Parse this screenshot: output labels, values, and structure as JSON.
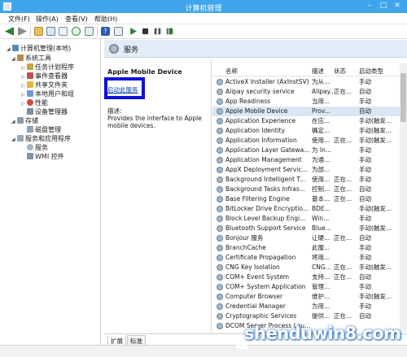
{
  "window": {
    "title": "计算机管理"
  },
  "menu": [
    "文件(F)",
    "操作(A)",
    "查看(V)",
    "帮助(H)"
  ],
  "tree": [
    {
      "label": "计算机管理(本地)",
      "level": 0,
      "expanded": true,
      "icon": "computer-icon"
    },
    {
      "label": "系统工具",
      "level": 1,
      "expanded": true,
      "icon": "tools-icon"
    },
    {
      "label": "任务计划程序",
      "level": 2,
      "expanded": false,
      "icon": "task-scheduler-icon"
    },
    {
      "label": "事件查看器",
      "level": 2,
      "expanded": false,
      "icon": "event-viewer-icon"
    },
    {
      "label": "共享文件夹",
      "level": 2,
      "expanded": false,
      "icon": "shared-folder-icon"
    },
    {
      "label": "本地用户和组",
      "level": 2,
      "expanded": false,
      "icon": "users-icon"
    },
    {
      "label": "性能",
      "level": 2,
      "expanded": false,
      "icon": "performance-icon"
    },
    {
      "label": "设备管理器",
      "level": 2,
      "expanded": null,
      "icon": "device-manager-icon"
    },
    {
      "label": "存储",
      "level": 1,
      "expanded": true,
      "icon": "storage-icon"
    },
    {
      "label": "磁盘管理",
      "level": 2,
      "expanded": null,
      "icon": "disk-icon"
    },
    {
      "label": "服务和应用程序",
      "level": 1,
      "expanded": true,
      "icon": "services-apps-icon"
    },
    {
      "label": "服务",
      "level": 2,
      "expanded": null,
      "icon": "services-icon"
    },
    {
      "label": "WMI 控件",
      "level": 2,
      "expanded": null,
      "icon": "wmi-icon"
    }
  ],
  "main": {
    "header_title": "服务",
    "selected_service": "Apple Mobile Device",
    "start_link": "启动此服务",
    "desc_label": "描述:",
    "desc_text": "Provides the interface to Apple mobile devices."
  },
  "columns": [
    "名称",
    "描述",
    "状态",
    "启动类型"
  ],
  "services": [
    {
      "name": "ActiveX Installer (AxInstSV)",
      "desc": "为从...",
      "status": "",
      "start": "手动"
    },
    {
      "name": "Alipay security service",
      "desc": "Alipay...",
      "status": "正在...",
      "start": "自动"
    },
    {
      "name": "App Readiness",
      "desc": "当用...",
      "status": "",
      "start": "手动"
    },
    {
      "name": "Apple Mobile Device",
      "desc": "Prov...",
      "status": "",
      "start": "自动"
    },
    {
      "name": "Application Experience",
      "desc": "在应...",
      "status": "",
      "start": "手动(触发..."
    },
    {
      "name": "Application Identity",
      "desc": "确定...",
      "status": "",
      "start": "手动(触发..."
    },
    {
      "name": "Application Information",
      "desc": "使用...",
      "status": "正在...",
      "start": "手动(触发..."
    },
    {
      "name": "Application Layer Gatewa...",
      "desc": "为 In...",
      "status": "",
      "start": "手动"
    },
    {
      "name": "Application Management",
      "desc": "为通...",
      "status": "",
      "start": "手动"
    },
    {
      "name": "AppX Deployment Servic...",
      "desc": "为部...",
      "status": "",
      "start": "手动"
    },
    {
      "name": "Background Intelligent T...",
      "desc": "使用...",
      "status": "正在...",
      "start": "手动"
    },
    {
      "name": "Background Tasks Infras...",
      "desc": "控制...",
      "status": "正在...",
      "start": "自动"
    },
    {
      "name": "Base Filtering Engine",
      "desc": "基本...",
      "status": "正在...",
      "start": "自动"
    },
    {
      "name": "BitLocker Drive Encryptio...",
      "desc": "BDE...",
      "status": "",
      "start": "手动(触发..."
    },
    {
      "name": "Block Level Backup Engi...",
      "desc": "Win...",
      "status": "",
      "start": "手动"
    },
    {
      "name": "Bluetooth Support Service",
      "desc": "Blue...",
      "status": "",
      "start": "手动(触发..."
    },
    {
      "name": "Bonjour 服务",
      "desc": "让硬...",
      "status": "正在...",
      "start": "自动"
    },
    {
      "name": "BranchCache",
      "desc": "此服...",
      "status": "",
      "start": "手动"
    },
    {
      "name": "Certificate Propagation",
      "desc": "将用...",
      "status": "",
      "start": "手动"
    },
    {
      "name": "CNG Key Isolation",
      "desc": "CNG...",
      "status": "正在...",
      "start": "手动(触发..."
    },
    {
      "name": "COM+ Event System",
      "desc": "支持...",
      "status": "正在...",
      "start": "自动"
    },
    {
      "name": "COM+ System Application",
      "desc": "管理...",
      "status": "",
      "start": "手动"
    },
    {
      "name": "Computer Browser",
      "desc": "维护...",
      "status": "",
      "start": "手动(触发..."
    },
    {
      "name": "Credential Manager",
      "desc": "为用...",
      "status": "",
      "start": "手动"
    },
    {
      "name": "Cryptographic Services",
      "desc": "提供...",
      "status": "正在...",
      "start": "自动"
    },
    {
      "name": "DCOM Server Process Lau...",
      "desc": "",
      "status": "",
      "start": ""
    }
  ],
  "selected_index": 3,
  "tabs": [
    "扩展",
    "标准"
  ],
  "watermark": "shenduwin8.com"
}
